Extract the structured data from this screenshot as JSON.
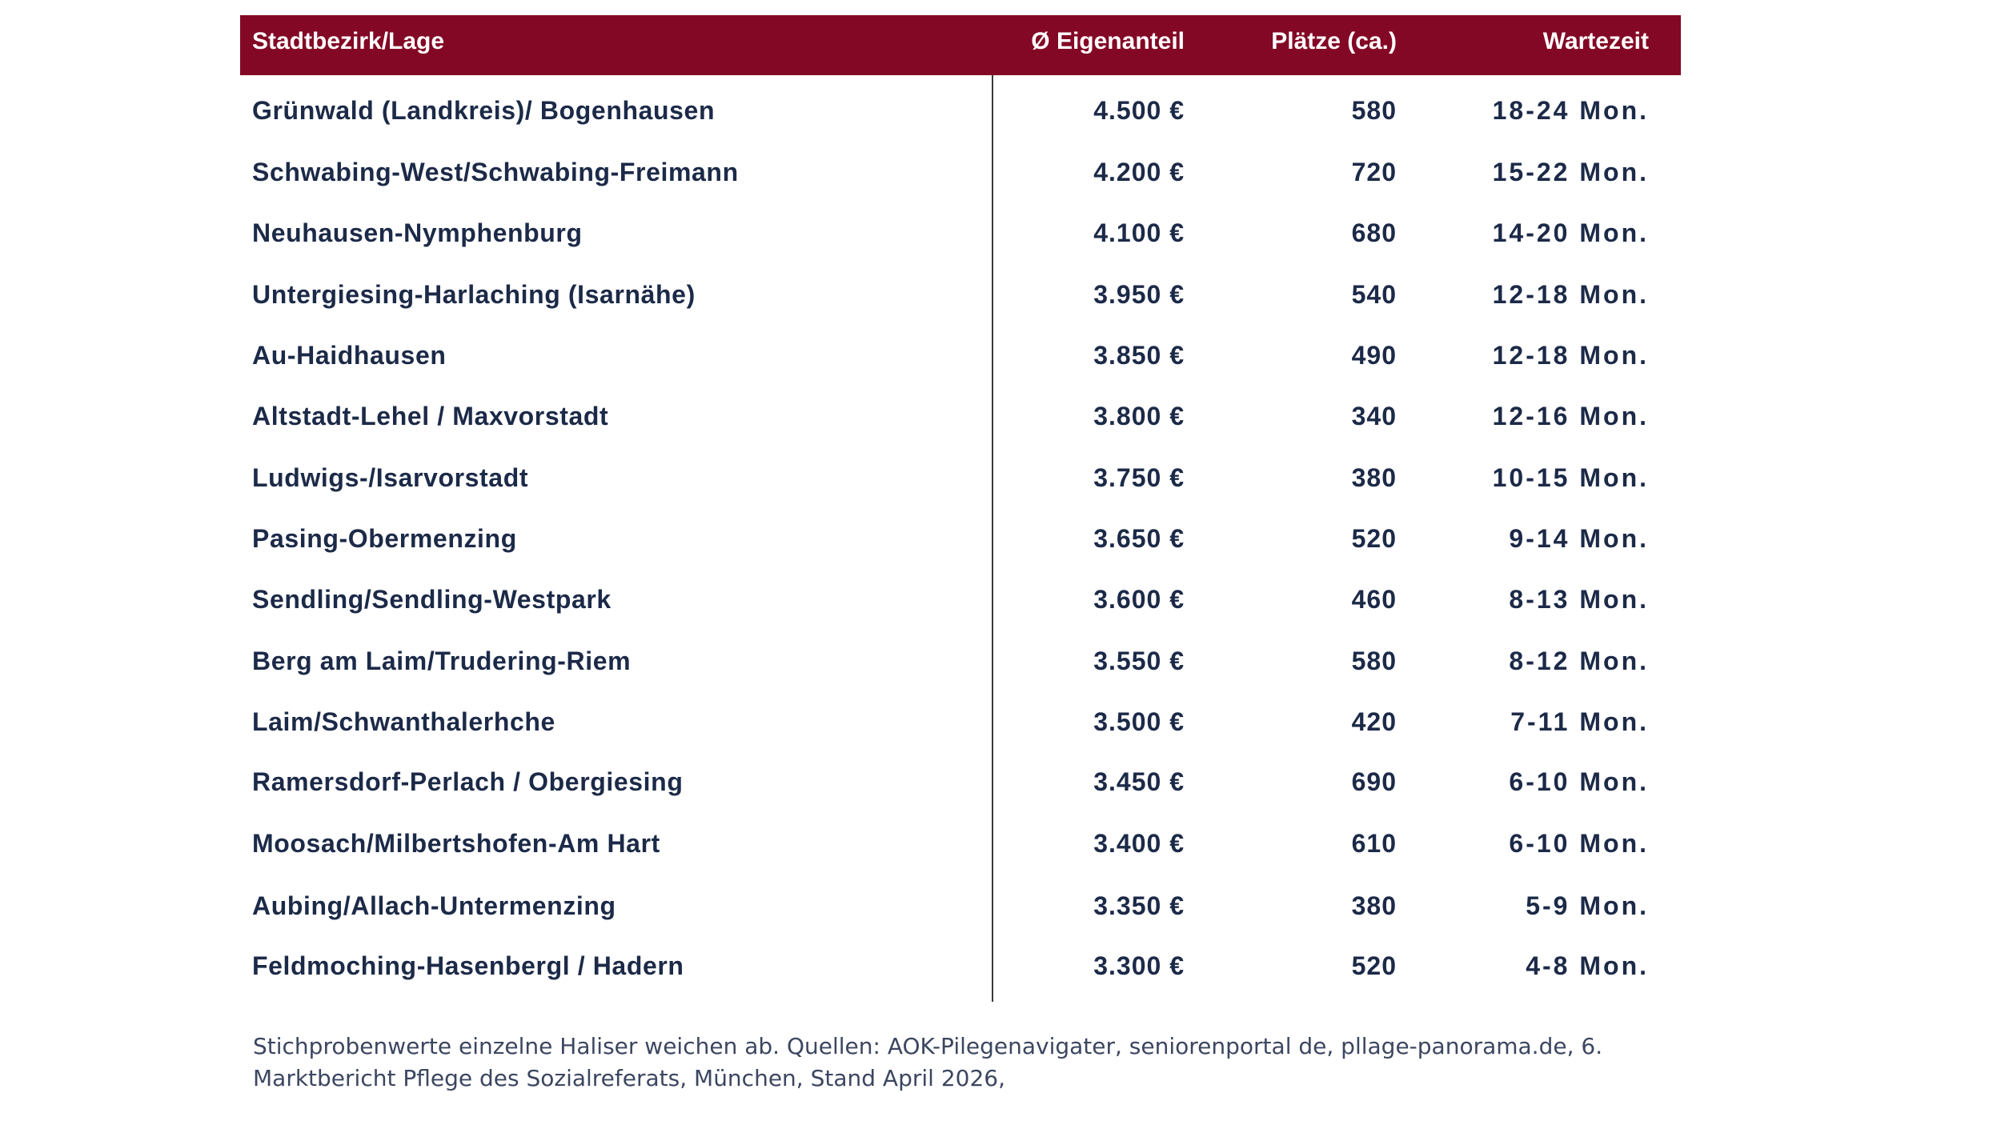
{
  "table": {
    "headers": {
      "bezirk": "Stadtbezirk/Lage",
      "eigenanteil": "Ø Eigenanteil",
      "plaetze": "Plätze (ca.)",
      "wartezeit": "Wartezeit"
    },
    "rows": [
      {
        "bezirk": "Grünwald (Landkreis)/ Bogenhausen",
        "eigenanteil": "4.500 €",
        "plaetze": "580",
        "wartezeit": "18-24 Mon."
      },
      {
        "bezirk": "Schwabing-West/Schwabing-Freimann",
        "eigenanteil": "4.200 €",
        "plaetze": "720",
        "wartezeit": "15-22 Mon."
      },
      {
        "bezirk": "Neuhausen-Nymphenburg",
        "eigenanteil": "4.100 €",
        "plaetze": "680",
        "wartezeit": "14-20 Mon."
      },
      {
        "bezirk": "Untergiesing-Harlaching (Isarnähe)",
        "eigenanteil": "3.950 €",
        "plaetze": "540",
        "wartezeit": "12-18 Mon."
      },
      {
        "bezirk": "Au-Haidhausen",
        "eigenanteil": "3.850 €",
        "plaetze": "490",
        "wartezeit": "12-18 Mon."
      },
      {
        "bezirk": "Altstadt-Lehel / Maxvorstadt",
        "eigenanteil": "3.800 €",
        "plaetze": "340",
        "wartezeit": "12-16 Mon."
      },
      {
        "bezirk": "Ludwigs-/Isarvorstadt",
        "eigenanteil": "3.750 €",
        "plaetze": "380",
        "wartezeit": "10-15 Mon."
      },
      {
        "bezirk": "Pasing-Obermenzing",
        "eigenanteil": "3.650 €",
        "plaetze": "520",
        "wartezeit": "9-14 Mon."
      },
      {
        "bezirk": "Sendling/Sendling-Westpark",
        "eigenanteil": "3.600 €",
        "plaetze": "460",
        "wartezeit": "8-13 Mon."
      },
      {
        "bezirk": "Berg am Laim/Trudering-Riem",
        "eigenanteil": "3.550 €",
        "plaetze": "580",
        "wartezeit": "8-12 Mon."
      },
      {
        "bezirk": "Laim/Schwanthalerhche",
        "eigenanteil": "3.500 €",
        "plaetze": "420",
        "wartezeit": "7-11 Mon."
      },
      {
        "bezirk": "Ramersdorf-Perlach / Obergiesing",
        "eigenanteil": "3.450 €",
        "plaetze": "690",
        "wartezeit": "6-10 Mon."
      },
      {
        "bezirk": "Moosach/Milbertshofen-Am Hart",
        "eigenanteil": "3.400 €",
        "plaetze": "610",
        "wartezeit": "6-10 Mon."
      },
      {
        "bezirk": "Aubing/Allach-Untermenzing",
        "eigenanteil": "3.350 €",
        "plaetze": "380",
        "wartezeit": "5-9 Mon."
      },
      {
        "bezirk": "Feldmoching-Hasenbergl / Hadern",
        "eigenanteil": "3.300 €",
        "plaetze": "520",
        "wartezeit": "4-8 Mon."
      }
    ]
  },
  "footnote": "Stichprobenwerte einzelne Haliser weichen ab. Quellen: AOK-Pilegenavigater, seniorenportal de, pllage-panorama.de, 6. Marktbericht Pflege des Sozialreferats, München, Stand April 2026,",
  "colors": {
    "header_bg": "#830825",
    "header_text": "#ffffff",
    "body_text": "#1c2a48",
    "footnote_text": "#3c4660"
  }
}
